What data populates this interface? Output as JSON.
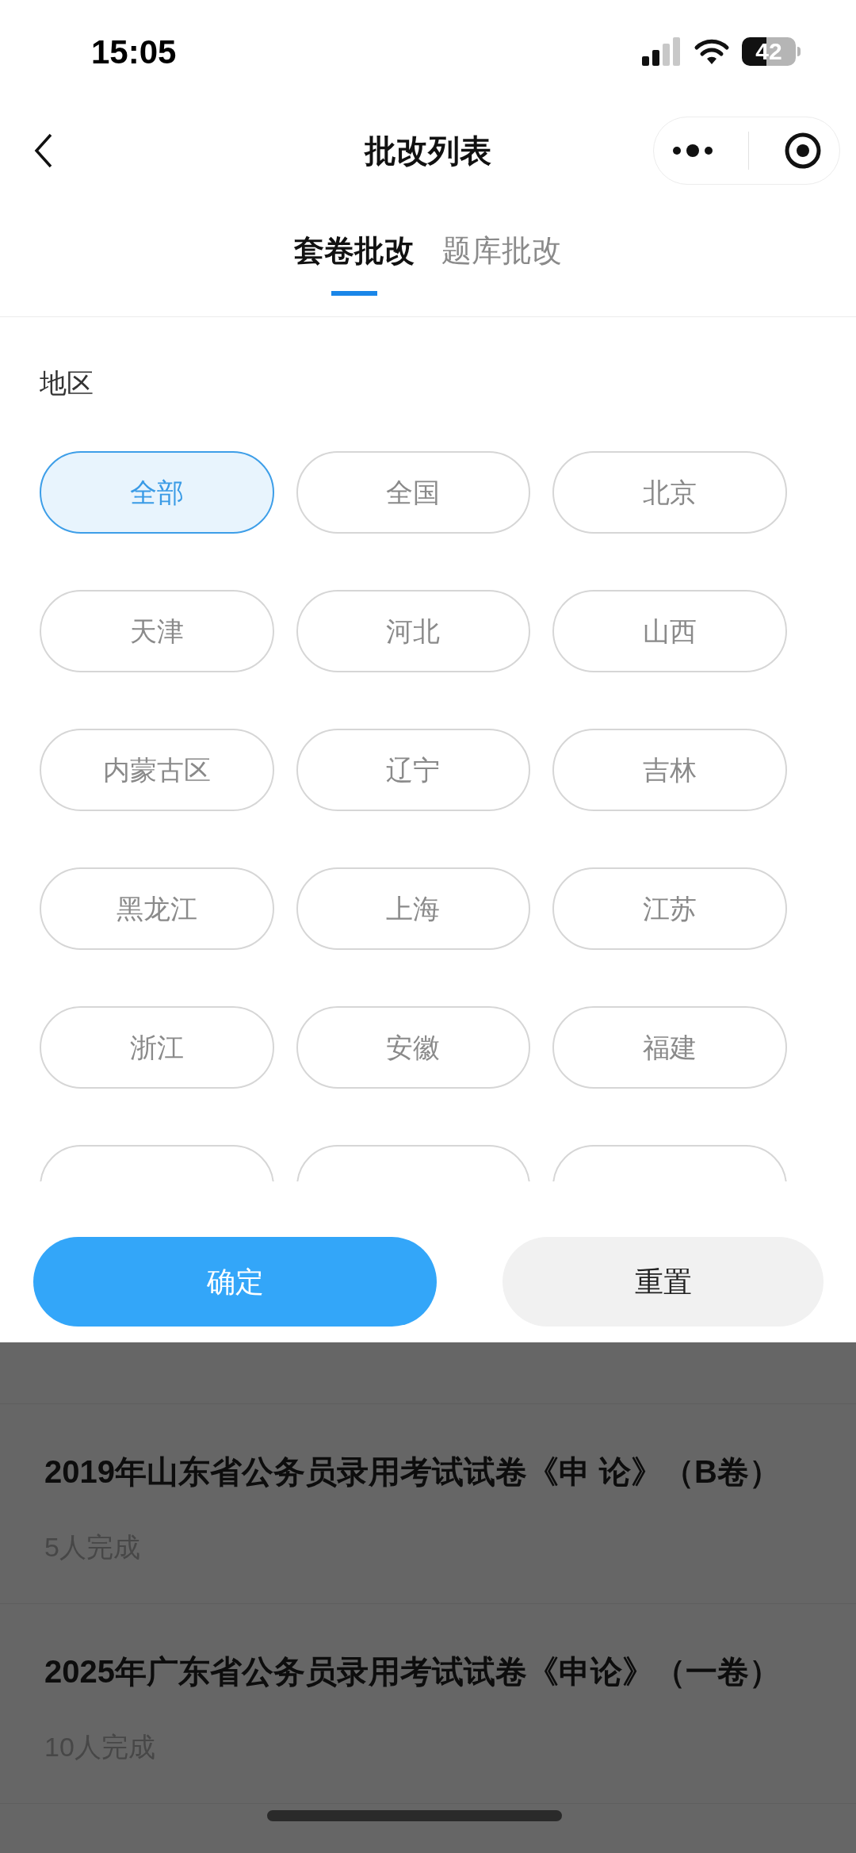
{
  "status_bar": {
    "time": "15:05",
    "battery": "42"
  },
  "nav": {
    "title": "批改列表"
  },
  "tabs": [
    {
      "label": "套卷批改",
      "selected": true
    },
    {
      "label": "题库批改",
      "selected": false
    }
  ],
  "filter": {
    "heading": "地区",
    "options": [
      {
        "label": "全部",
        "selected": true
      },
      {
        "label": "全国",
        "selected": false
      },
      {
        "label": "北京",
        "selected": false
      },
      {
        "label": "天津",
        "selected": false
      },
      {
        "label": "河北",
        "selected": false
      },
      {
        "label": "山西",
        "selected": false
      },
      {
        "label": "内蒙古区",
        "selected": false
      },
      {
        "label": "辽宁",
        "selected": false
      },
      {
        "label": "吉林",
        "selected": false
      },
      {
        "label": "黑龙江",
        "selected": false
      },
      {
        "label": "上海",
        "selected": false
      },
      {
        "label": "江苏",
        "selected": false
      },
      {
        "label": "浙江",
        "selected": false
      },
      {
        "label": "安徽",
        "selected": false
      },
      {
        "label": "福建",
        "selected": false
      },
      {
        "selected": false
      },
      {
        "selected": false
      },
      {
        "selected": false
      }
    ],
    "buttons": [
      {
        "kind": "primary",
        "label": "确定"
      },
      {
        "kind": "secondary",
        "label": "重置"
      }
    ]
  },
  "papers": [
    {
      "title": "2019年山东省公务员录用考试试卷《申 论》（B卷）",
      "completed": "5人完成"
    },
    {
      "title": "2025年广东省公务员录用考试试卷《申论》（一卷）",
      "completed": "10人完成"
    }
  ]
}
